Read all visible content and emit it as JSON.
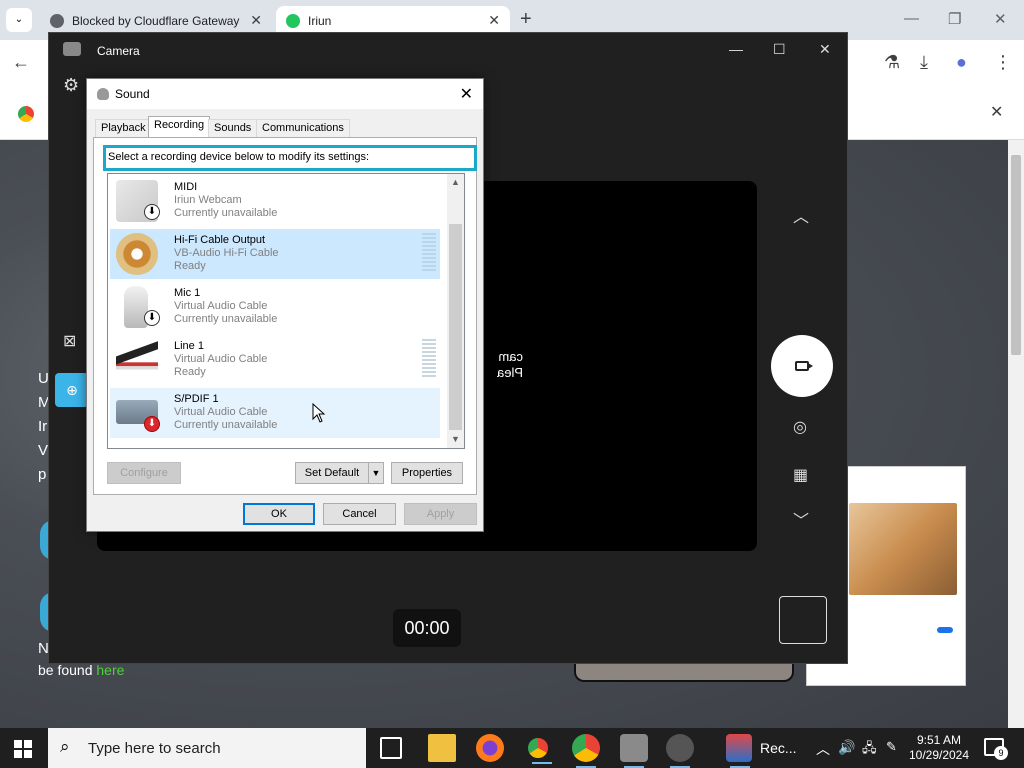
{
  "browser": {
    "tabs": [
      {
        "title": "Blocked by Cloudflare Gateway",
        "close": "✕"
      },
      {
        "title": "Iriun",
        "close": "✕"
      }
    ],
    "new_tab": "+",
    "tab_search": "⌄",
    "win_min": "—",
    "win_max": "❐",
    "win_close": "✕",
    "toolbar": {
      "back": "←",
      "labs": "⚗",
      "download": "⤓",
      "profile": "●",
      "menu": "⋮"
    },
    "infobar_close": "✕"
  },
  "page": {
    "lines": [
      "U",
      "M",
      "Ir",
      "V",
      "p"
    ],
    "footer_prefix": "N",
    "footer_text": "be found ",
    "footer_link": "here"
  },
  "camera": {
    "title": "Camera",
    "controls": {
      "min": "—",
      "max": "☐",
      "close": "✕"
    },
    "preview_msg": [
      "cam",
      "Plea"
    ],
    "timer": "00:00",
    "icons": {
      "up": "︿",
      "down": "﹀",
      "photo": "◎",
      "qr": "▦",
      "settings": "⚙",
      "no_cam": "⊠",
      "zoom": "⊕"
    }
  },
  "sound": {
    "title": "Sound",
    "close": "✕",
    "tabs": [
      "Playback",
      "Recording",
      "Sounds",
      "Communications"
    ],
    "active_tab": "Recording",
    "instruction": "Select a recording device below to modify its settings:",
    "devices": [
      {
        "name": "MIDI",
        "driver": "Iriun Webcam",
        "status": "Currently unavailable"
      },
      {
        "name": "Hi-Fi Cable Output",
        "driver": "VB-Audio Hi-Fi Cable",
        "status": "Ready"
      },
      {
        "name": "Mic 1",
        "driver": "Virtual Audio Cable",
        "status": "Currently unavailable"
      },
      {
        "name": "Line 1",
        "driver": "Virtual Audio Cable",
        "status": "Ready"
      },
      {
        "name": "S/PDIF 1",
        "driver": "Virtual Audio Cable",
        "status": "Currently unavailable"
      }
    ],
    "buttons": {
      "configure": "Configure",
      "set_default": "Set Default",
      "properties": "Properties",
      "ok": "OK",
      "cancel": "Cancel",
      "apply": "Apply"
    },
    "scroll_up": "▲",
    "scroll_down": "▼",
    "dropdown": "▼"
  },
  "taskbar": {
    "search_placeholder": "Type here to search",
    "search_icon": "⌕",
    "task_label": "Rec...",
    "tray_arrow": "︿",
    "clock_time": "9:51 AM",
    "clock_date": "10/29/2024",
    "notification_count": "9"
  },
  "colors": {
    "accent": "#1ba8c9",
    "selection": "#cce8ff",
    "taskbar": "#1f1f1f",
    "link": "#4cd137"
  }
}
